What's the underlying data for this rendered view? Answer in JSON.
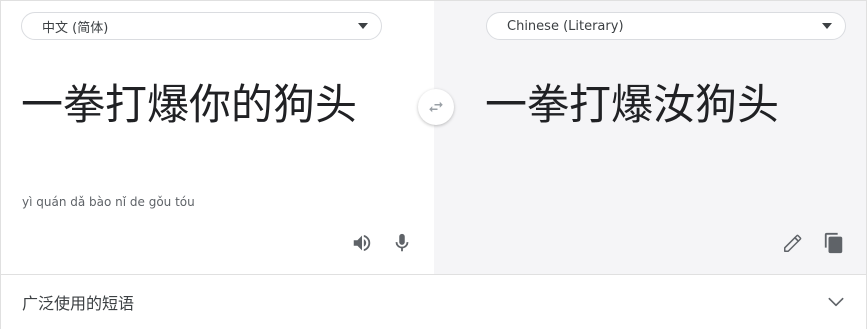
{
  "source": {
    "language": "中文 (简体)",
    "text": "一拳打爆你的狗头",
    "romanization": "yì quán dǎ bào nǐ de gǒu tóu"
  },
  "target": {
    "language": "Chinese (Literary)",
    "text": "一拳打爆汝狗头"
  },
  "footer": {
    "label": "广泛使用的短语"
  },
  "icons": {
    "swap": "swap-arrows-icon",
    "speaker": "speaker-icon",
    "mic": "microphone-icon",
    "edit": "pencil-icon",
    "copy": "copy-icon",
    "expand": "chevron-down-icon"
  },
  "colors": {
    "icon": "#5f6368",
    "target_pane_bg": "#f5f5f7",
    "border": "#e0e0e0"
  }
}
